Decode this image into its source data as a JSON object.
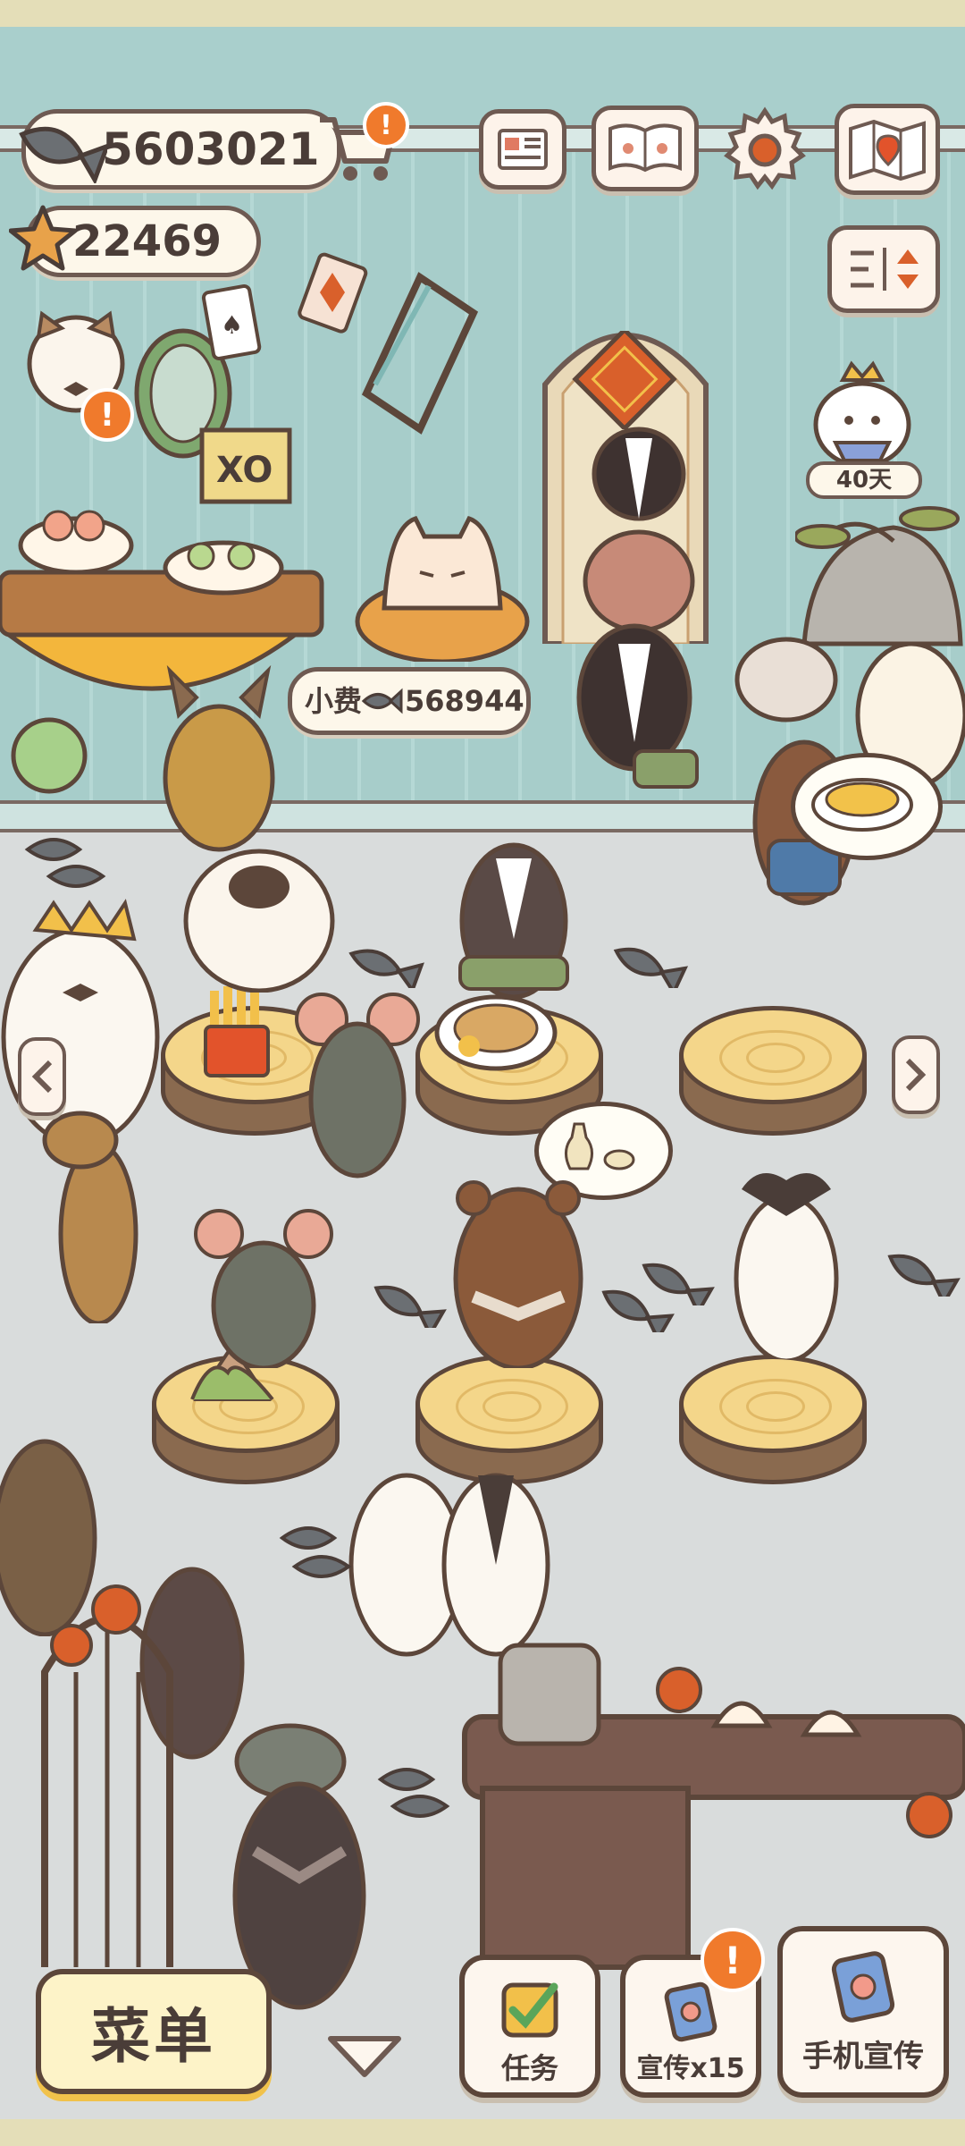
{
  "currency": {
    "fish_amount": "5603021",
    "star_amount": "22469",
    "fish_icon": "fish-icon",
    "star_icon": "star-icon"
  },
  "notifications": {
    "alert_glyph": "!"
  },
  "tip": {
    "label": "小费",
    "amount": "568944"
  },
  "event": {
    "days_left": "40天"
  },
  "bottom_bar": {
    "menu_label": "菜单",
    "task_label": "任务",
    "promo_label": "宣传x15",
    "phone_promo_label": "手机宣传"
  },
  "colors": {
    "accent_orange": "#f07a2c",
    "outline_brown": "#5c463a",
    "wall_teal": "#a9cfcc",
    "floor_gray": "#d9dcdc",
    "stump_top": "#f4d68a",
    "menu_yellow": "#fdf3c8"
  }
}
